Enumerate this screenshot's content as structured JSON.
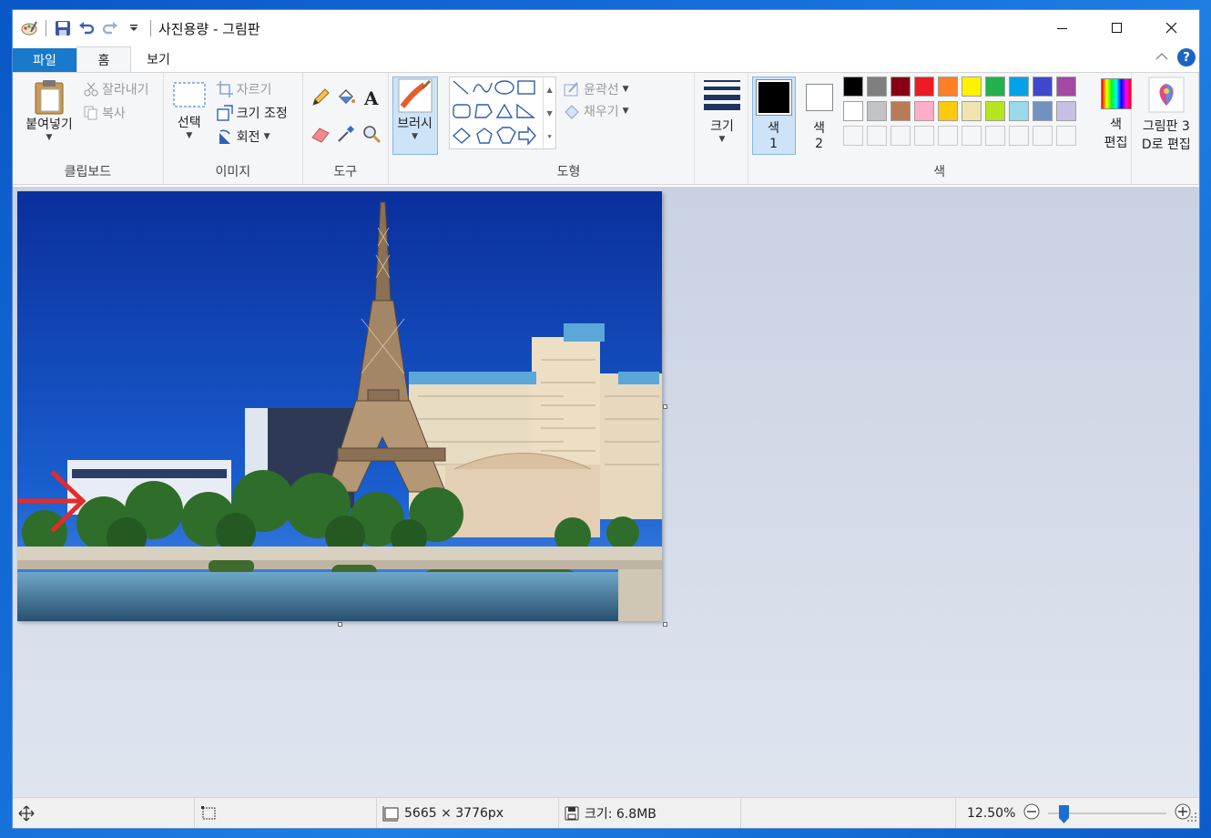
{
  "window": {
    "title": "사진용량 - 그림판"
  },
  "tabs": {
    "file": "파일",
    "home": "홈",
    "view": "보기"
  },
  "ribbon": {
    "clipboard": {
      "label": "클립보드",
      "paste": "붙여넣기",
      "cut": "잘라내기",
      "copy": "복사"
    },
    "image": {
      "label": "이미지",
      "select": "선택",
      "crop": "자르기",
      "resize": "크기 조정",
      "rotate": "회전"
    },
    "tools": {
      "label": "도구"
    },
    "brush": {
      "label": "브러시"
    },
    "shapes": {
      "label": "도형",
      "outline": "윤곽선",
      "fill": "채우기"
    },
    "size": {
      "label": "크기"
    },
    "colors": {
      "label": "색",
      "color1": "색",
      "color1_num": "1",
      "color2": "색",
      "color2_num": "2",
      "edit_colors_1": "색",
      "edit_colors_2": "편집",
      "palette_row1": [
        "#000000",
        "#7f7f7f",
        "#880015",
        "#ed1c24",
        "#ff7f27",
        "#fff200",
        "#22b14c",
        "#00a2e8",
        "#3f48cc",
        "#a349a4"
      ],
      "palette_row2": [
        "#ffffff",
        "#c3c3c3",
        "#b97a57",
        "#ffaec9",
        "#ffc90e",
        "#efe4b0",
        "#b5e61d",
        "#99d9ea",
        "#7092be",
        "#c8bfe7"
      ]
    },
    "paint3d": {
      "line1": "그림판 3",
      "line2": "D로 편집"
    }
  },
  "status": {
    "dimensions": "5665 × 3776px",
    "file_size": "크기: 6.8MB",
    "zoom": "12.50%",
    "zoom_level": 0.1
  }
}
